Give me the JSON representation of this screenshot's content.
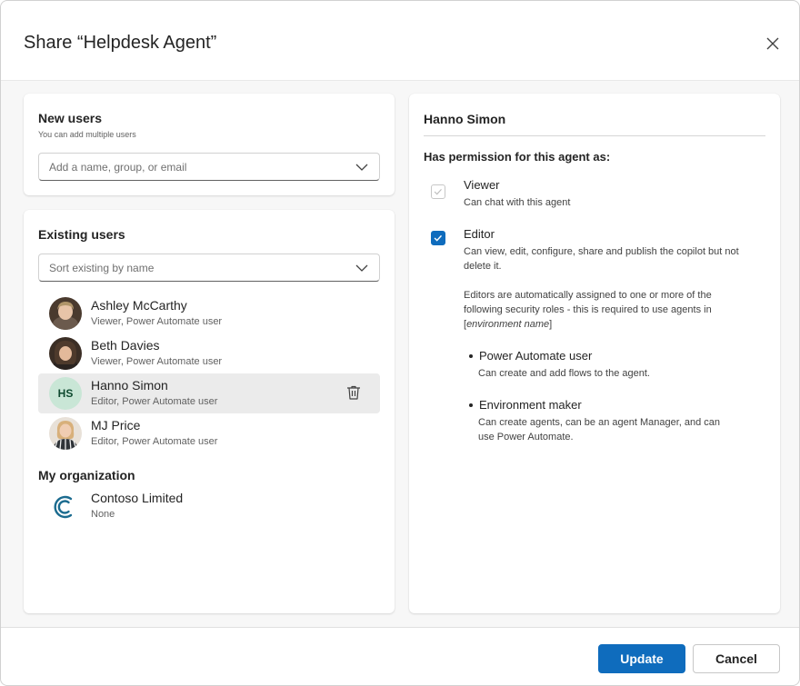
{
  "dialog": {
    "title": "Share “Helpdesk Agent”",
    "close_icon": "close-icon"
  },
  "new_users": {
    "heading": "New users",
    "hint": "You can add multiple users",
    "input_placeholder": "Add a name, group, or email"
  },
  "existing_users": {
    "heading": "Existing users",
    "sort_placeholder": "Sort existing by name",
    "users": [
      {
        "name": "Ashley McCarthy",
        "role": "Viewer, Power Automate user"
      },
      {
        "name": "Beth Davies",
        "role": "Viewer, Power Automate user"
      },
      {
        "name": "Hanno Simon",
        "role": "Editor, Power Automate user",
        "initials": "HS",
        "selected": true
      },
      {
        "name": "MJ Price",
        "role": "Editor, Power Automate user"
      }
    ]
  },
  "organization": {
    "heading": "My organization",
    "name": "Contoso Limited",
    "role": "None"
  },
  "detail": {
    "user_name": "Hanno Simon",
    "permission_heading": "Has permission for this agent as:",
    "viewer": {
      "title": "Viewer",
      "desc": "Can chat with this agent",
      "checked": true,
      "disabled": true
    },
    "editor": {
      "title": "Editor",
      "desc_line1": "Can view, edit, configure, share and publish the copilot but not",
      "desc_line2": "delete it.",
      "note_line1": "Editors are automatically assigned to one or more of the",
      "note_line2": "following security roles - this is required to use agents in",
      "note_line3_open": "[",
      "note_line3_italic": "environment name",
      "note_line3_close": "]",
      "checked": true
    },
    "roles": [
      {
        "title": "Power Automate user",
        "desc_line1": "Can create and add flows to the agent.",
        "desc_line2": ""
      },
      {
        "title": "Environment maker",
        "desc_line1": "Can create agents, can be an agent Manager, and can",
        "desc_line2": "use Power Automate."
      }
    ]
  },
  "footer": {
    "update_label": "Update",
    "cancel_label": "Cancel"
  },
  "colors": {
    "accent": "#0f6cbd",
    "contoso_logo": "#1b6b8f"
  }
}
